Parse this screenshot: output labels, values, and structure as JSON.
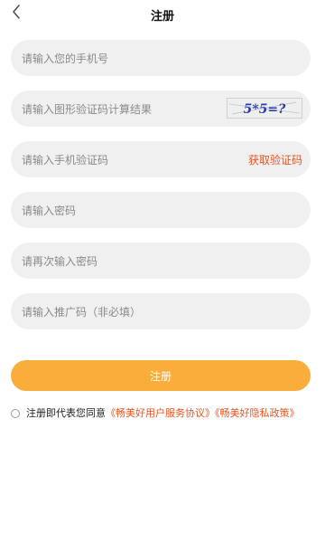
{
  "header": {
    "title": "注册",
    "back_icon": "chevron-left-icon"
  },
  "form": {
    "phone_placeholder": "请输入您的手机号",
    "captcha_placeholder": "请输入图形验证码计算结果",
    "captcha_image_text": "5*5=?",
    "sms_placeholder": "请输入手机验证码",
    "get_code_label": "获取验证码",
    "password_placeholder": "请输入密码",
    "password_confirm_placeholder": "请再次输入密码",
    "referral_placeholder": "请输入推广码（非必填）"
  },
  "submit_label": "注册",
  "agreement": {
    "prefix": "注册即代表您同意",
    "user_agreement": "《畅美好用户服务协议》",
    "privacy_policy": "《畅美好隐私政策》"
  },
  "colors": {
    "accent": "#f9ad3a",
    "link": "#e8541e",
    "field_bg": "#f0f0f0"
  }
}
